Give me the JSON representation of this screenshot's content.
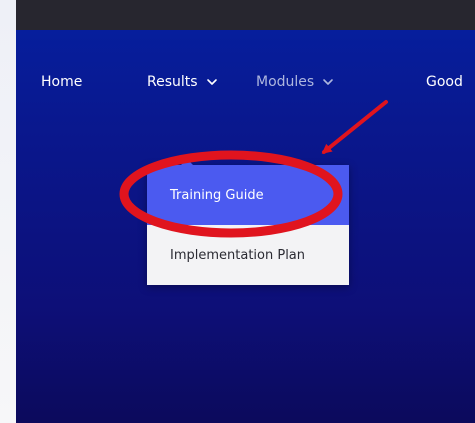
{
  "nav": {
    "items": [
      {
        "label": "Home",
        "has_dropdown": false
      },
      {
        "label": "Results",
        "has_dropdown": true
      },
      {
        "label": "Modules",
        "has_dropdown": true
      },
      {
        "label": "Good",
        "has_dropdown": false
      }
    ]
  },
  "dropdown": {
    "items": [
      {
        "label": "Training Guide",
        "state": "highlighted"
      },
      {
        "label": "Implementation Plan",
        "state": "normal"
      }
    ]
  },
  "colors": {
    "topbar": "#27262f",
    "hero_top": "#061e9c",
    "hero_bottom": "#0c0a5c",
    "highlight": "#4b5af0",
    "annotation_red": "#e0141e"
  },
  "icons": {
    "dropdown_indicator": "chevron-down-icon",
    "annotation_arrow": "arrow-icon",
    "annotation_circle": "circle-highlight"
  }
}
